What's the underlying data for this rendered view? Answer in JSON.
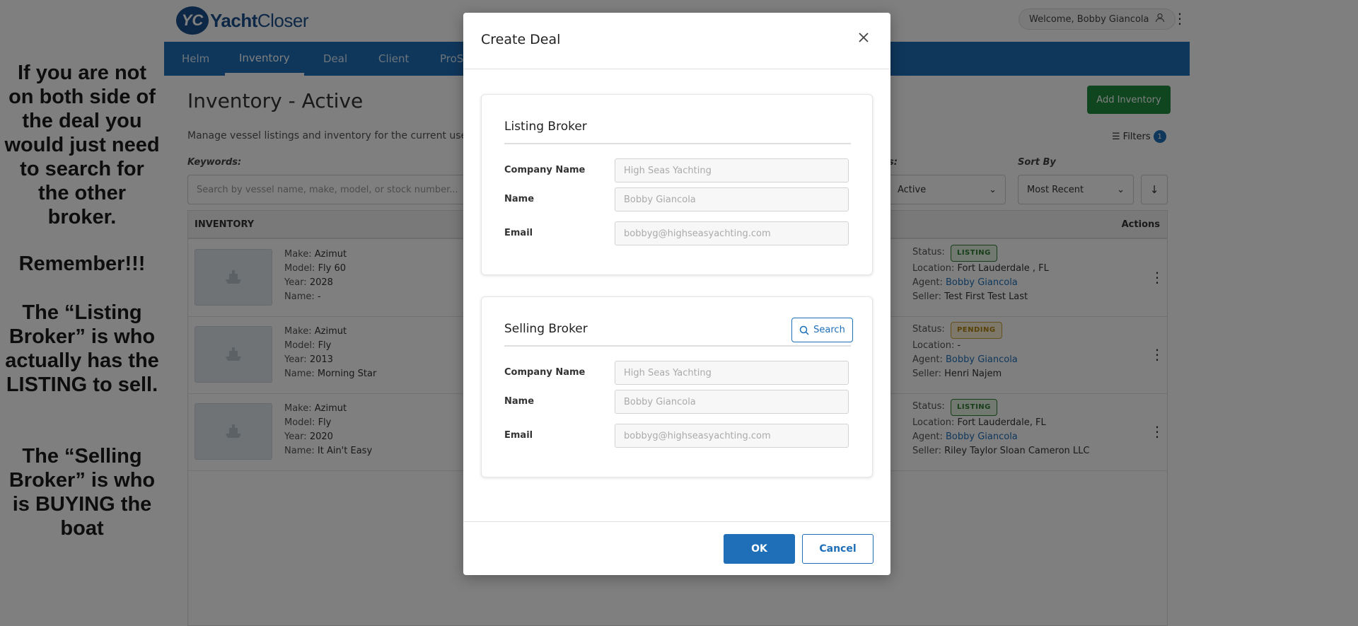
{
  "annotation": {
    "paragraph1": "If you are not on both side of the deal you would just need to search for the other broker.",
    "paragraph2": "Remember!!!",
    "paragraph3": "The “Listing Broker” is who actually has the LISTING to sell.",
    "paragraph4": "The “Selling Broker” is who is BUYING the boat"
  },
  "header": {
    "logo_mark": "YC",
    "logo_brand_a": "Yacht",
    "logo_brand_b": "Closer",
    "welcome": "Welcome, Bobby Giancola"
  },
  "nav": {
    "items": [
      "Helm",
      "Inventory",
      "Deal",
      "Client",
      "ProS"
    ],
    "active": "Inventory"
  },
  "page": {
    "title": "Inventory - Active",
    "subtitle": "Manage vessel listings and inventory for the current user.",
    "add_button": "Add Inventory",
    "filters_label": "Filters",
    "filters_count": "1",
    "keywords_label": "Keywords:",
    "search_placeholder": "Search by vessel name, make, model, or stock number...",
    "status_label": "s:",
    "status_value": "Active",
    "sort_label": "Sort By",
    "sort_value": "Most Recent"
  },
  "table": {
    "header_left": "INVENTORY",
    "header_right": "Actions",
    "key_make": "Make:",
    "key_model": "Model:",
    "key_year": "Year:",
    "key_name": "Name:",
    "key_status": "Status:",
    "key_location": "Location:",
    "key_agent": "Agent:",
    "key_seller": "Seller:",
    "rows": [
      {
        "make": "Azimut",
        "model": "Fly 60",
        "year": "2028",
        "name": "-",
        "status": "LISTING",
        "location": "Fort Lauderdale , FL",
        "agent": "Bobby Giancola",
        "seller": "Test First Test Last"
      },
      {
        "make": "Azimut",
        "model": "Fly",
        "year": "2013",
        "name": "Morning Star",
        "status": "PENDING",
        "location": "-",
        "agent": "Bobby Giancola",
        "seller": "Henri Najem"
      },
      {
        "make": "Azimut",
        "model": "Fly",
        "year": "2020",
        "name": "It Ain't Easy",
        "status": "LISTING",
        "location": "Fort Lauderdale, FL",
        "agent": "Bobby Giancola",
        "seller": "Riley Taylor Sloan Cameron LLC"
      }
    ]
  },
  "modal": {
    "title": "Create Deal",
    "listing": {
      "title": "Listing Broker",
      "company_label": "Company Name",
      "company_placeholder": "High Seas Yachting",
      "name_label": "Name",
      "name_placeholder": "Bobby Giancola",
      "email_label": "Email",
      "email_placeholder": "bobbyg@highseasyachting.com"
    },
    "selling": {
      "title": "Selling Broker",
      "search_button": "Search",
      "company_label": "Company Name",
      "company_placeholder": "High Seas Yachting",
      "name_label": "Name",
      "name_placeholder": "Bobby Giancola",
      "email_label": "Email",
      "email_placeholder": "bobbyg@highseasyachting.com"
    },
    "ok": "OK",
    "cancel": "Cancel"
  }
}
